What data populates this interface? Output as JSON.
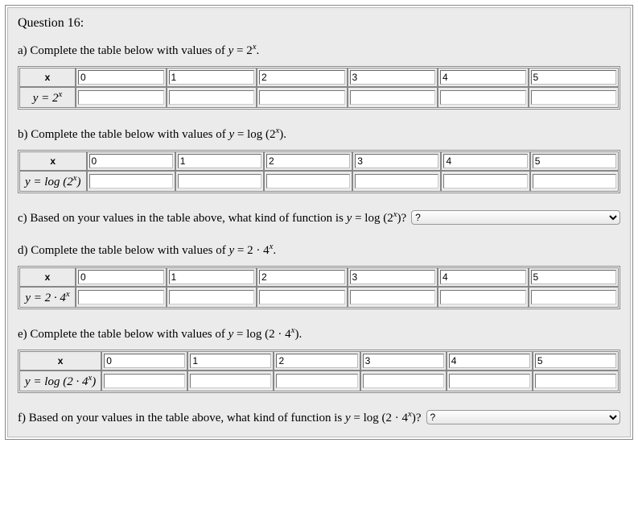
{
  "question_title": "Question 16:",
  "parts": {
    "a": {
      "prefix": "a) Complete the table below with values of ",
      "expr_html": "<span class='math-var'>y</span> = 2<span class='math-sup'>x</span>",
      "suffix": ".",
      "x_label": "x",
      "row_label_html": "<span class='math-var'>y</span> = 2<span class='math-sup'>x</span>",
      "columns": [
        "0",
        "1",
        "2",
        "3",
        "4",
        "5"
      ]
    },
    "b": {
      "prefix": "b) Complete the table below with values of ",
      "expr_html": "<span class='math-var'>y</span> = log (2<span class='math-sup'>x</span>)",
      "suffix": ".",
      "x_label": "x",
      "row_label_html": "<span class='math-var'>y</span> = log (2<span class='math-sup'>x</span>)",
      "columns": [
        "0",
        "1",
        "2",
        "3",
        "4",
        "5"
      ]
    },
    "c": {
      "prefix": "c) Based on your values in the table above, what kind of function is ",
      "expr_html": "<span class='math-var'>y</span> = log (2<span class='math-sup'>x</span>)",
      "suffix": "?",
      "dropdown_placeholder": "?"
    },
    "d": {
      "prefix": "d) Complete the table below with values of ",
      "expr_html": "<span class='math-var'>y</span> = 2 · 4<span class='math-sup'>x</span>",
      "suffix": ".",
      "x_label": "x",
      "row_label_html": "<span class='math-var'>y</span> = 2 · 4<span class='math-sup'>x</span>",
      "columns": [
        "0",
        "1",
        "2",
        "3",
        "4",
        "5"
      ]
    },
    "e": {
      "prefix": "e) Complete the table below with values of ",
      "expr_html": "<span class='math-var'>y</span> = log (2 · 4<span class='math-sup'>x</span>)",
      "suffix": ".",
      "x_label": "x",
      "row_label_html": "<span class='math-var'>y</span> = log (2 · 4<span class='math-sup'>x</span>)",
      "columns": [
        "0",
        "1",
        "2",
        "3",
        "4",
        "5"
      ]
    },
    "f": {
      "prefix": "f) Based on your values in the table above, what kind of function is ",
      "expr_html": "<span class='math-var'>y</span> = log (2 · 4<span class='math-sup'>x</span>)",
      "suffix": "?",
      "dropdown_placeholder": "?"
    }
  }
}
